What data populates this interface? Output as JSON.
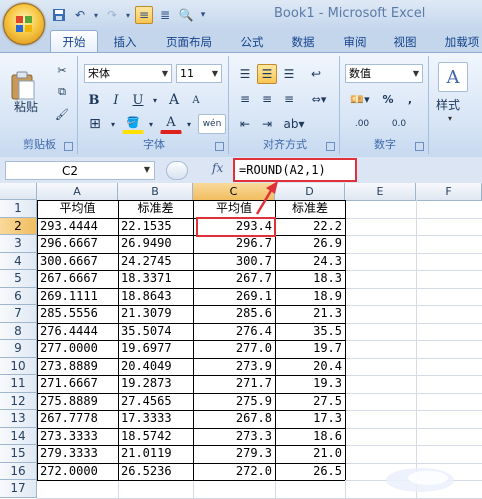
{
  "window": {
    "title": "Book1 - Microsoft Excel"
  },
  "quick_access": [
    "save-icon",
    "undo-icon",
    "redo-icon",
    "menu-icon",
    "format-icon",
    "preview-icon"
  ],
  "tabs": [
    "开始",
    "插入",
    "页面布局",
    "公式",
    "数据",
    "审阅",
    "视图",
    "加载项"
  ],
  "active_tab": "开始",
  "ribbon": {
    "clipboard": {
      "paste_label": "粘贴",
      "group_label": "剪贴板"
    },
    "font": {
      "font_name": "宋体",
      "font_size": "11",
      "bold": "B",
      "italic": "I",
      "underline": "U",
      "grow": "A",
      "shrink": "A",
      "font_color": "A",
      "phonetic": "wén",
      "group_label": "字体"
    },
    "alignment": {
      "group_label": "对齐方式"
    },
    "number": {
      "format": "数值",
      "percent": "%",
      "comma": ",",
      "inc_decimal": ".00",
      "dec_decimal": "0.0",
      "group_label": "数字"
    },
    "styles": {
      "label": "样式"
    }
  },
  "formula_bar": {
    "name_box": "C2",
    "fx": "fx",
    "formula": "=ROUND(A2,1)"
  },
  "columns": [
    "A",
    "B",
    "C",
    "D",
    "E",
    "F"
  ],
  "rows": [
    "1",
    "2",
    "3",
    "4",
    "5",
    "6",
    "7",
    "8",
    "9",
    "10",
    "11",
    "12",
    "13",
    "14",
    "15",
    "16",
    "17"
  ],
  "headers": [
    "平均值",
    "标准差",
    "平均值",
    "标准差"
  ],
  "data": [
    [
      "293.4444",
      "22.1535",
      "293.4",
      "22.2"
    ],
    [
      "296.6667",
      "26.9490",
      "296.7",
      "26.9"
    ],
    [
      "300.6667",
      "24.2745",
      "300.7",
      "24.3"
    ],
    [
      "267.6667",
      "18.3371",
      "267.7",
      "18.3"
    ],
    [
      "269.1111",
      "18.8643",
      "269.1",
      "18.9"
    ],
    [
      "285.5556",
      "21.3079",
      "285.6",
      "21.3"
    ],
    [
      "276.4444",
      "35.5074",
      "276.4",
      "35.5"
    ],
    [
      "277.0000",
      "19.6977",
      "277.0",
      "19.7"
    ],
    [
      "273.8889",
      "20.4049",
      "273.9",
      "20.4"
    ],
    [
      "271.6667",
      "19.2873",
      "271.7",
      "19.3"
    ],
    [
      "275.8889",
      "27.4565",
      "275.9",
      "27.5"
    ],
    [
      "267.7778",
      "17.3333",
      "267.8",
      "17.3"
    ],
    [
      "273.3333",
      "18.5742",
      "273.3",
      "18.6"
    ],
    [
      "279.3333",
      "21.0119",
      "279.3",
      "21.0"
    ],
    [
      "272.0000",
      "26.5236",
      "272.0",
      "26.5"
    ]
  ],
  "colors": {
    "highlight": "#e0313a",
    "selection": "#f1bd5f"
  }
}
